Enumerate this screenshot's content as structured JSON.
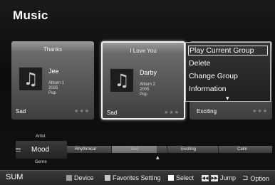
{
  "page": {
    "title": "Music"
  },
  "albums": [
    {
      "track": "Thanks",
      "artist": "Jee",
      "album": "Album 1",
      "year": "2005",
      "genre": "Pop",
      "mood": "Sad",
      "stars": "★★★",
      "icon": "music-note-icon",
      "note": "♫"
    },
    {
      "track": "I Love You",
      "artist": "Darby",
      "album": "Album 2",
      "year": "2005",
      "genre": "Pop",
      "mood": "Sad",
      "stars": "★★★",
      "icon": "music-note-icon",
      "note": "♫"
    },
    {
      "mood": "Exciting",
      "stars": "★★★"
    }
  ],
  "context_menu": {
    "items": [
      "Play Current Group",
      "Delete",
      "Change Group",
      "Information"
    ],
    "selected_index": 0,
    "more_arrow": "▼"
  },
  "category_selector": {
    "above": "Artist",
    "current": "Mood",
    "below": "Genre"
  },
  "mood_bar": {
    "segments": [
      "Rhythmical",
      "Sad",
      "Exciting",
      "Calm"
    ],
    "active": "Sad",
    "pointer": "▲"
  },
  "status_bar": {
    "source": "SUM",
    "hints": [
      {
        "color": "#9a9a9a",
        "label": "Device"
      },
      {
        "color": "#c8c8c8",
        "label": "Favorites Setting"
      },
      {
        "color": "#ffffff",
        "label": "Select"
      }
    ],
    "jump": {
      "icons": [
        "◀◀",
        "▶▶"
      ],
      "label": "Jump"
    },
    "option": {
      "icon": "tools-icon",
      "glyph": "⊐",
      "label": "Option"
    }
  }
}
